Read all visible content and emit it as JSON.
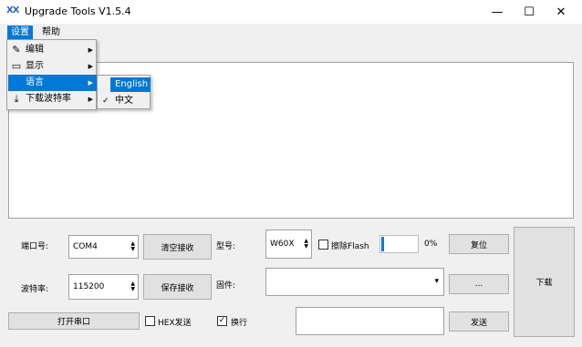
{
  "window": {
    "title": "Upgrade Tools V1.5.4",
    "minimize": "—",
    "maximize": "☐",
    "close": "✕"
  },
  "menubar": {
    "settings": "设置",
    "help": "帮助"
  },
  "dropdown": {
    "items": [
      {
        "label": "编辑",
        "icon": "edit-icon"
      },
      {
        "label": "显示",
        "icon": "monitor-icon"
      },
      {
        "label": "语言",
        "icon": ""
      },
      {
        "label": "下载波特率",
        "icon": "download-icon"
      }
    ]
  },
  "submenu": {
    "items": [
      {
        "label": "English",
        "checked": false
      },
      {
        "label": "中文",
        "checked": true
      }
    ]
  },
  "controls": {
    "port_label": "端口号:",
    "port_value": "COM4",
    "baud_label": "波特率:",
    "baud_value": "115200",
    "clear_btn": "清空接收",
    "save_btn": "保存接收",
    "model_label": "型号:",
    "model_value": "W60X",
    "erase_label": "擦除Flash",
    "erase_checked": false,
    "progress_text": "0%",
    "progress_fraction": 0.05,
    "reset_btn": "复位",
    "firmware_label": "固件:",
    "firmware_value": "",
    "browse_btn": "...",
    "download_btn": "下载",
    "open_port_btn": "打开串口",
    "hex_label": "HEX发送",
    "hex_checked": false,
    "newline_label": "换行",
    "newline_checked": true,
    "send_value": "",
    "send_btn": "发送"
  },
  "colors": {
    "accent": "#0078d7",
    "progress": "#0678d4"
  }
}
